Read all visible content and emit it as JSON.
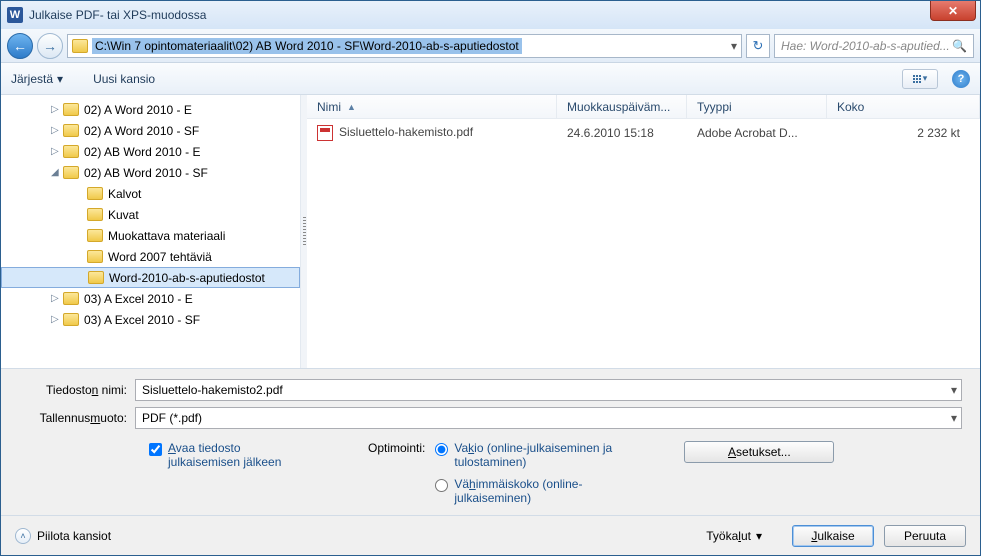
{
  "window": {
    "title": "Julkaise PDF- tai XPS-muodossa"
  },
  "nav": {
    "path": "C:\\Win 7 opintomateriaalit\\02) AB Word 2010 - SF\\Word-2010-ab-s-aputiedostot",
    "search_placeholder": "Hae: Word-2010-ab-s-aputied..."
  },
  "toolbar": {
    "organize": "Järjestä",
    "newfolder": "Uusi kansio"
  },
  "tree": [
    {
      "label": "02) A Word 2010 - E",
      "indent": 40,
      "exp": "▷"
    },
    {
      "label": "02) A Word 2010 - SF",
      "indent": 40,
      "exp": "▷"
    },
    {
      "label": "02) AB Word 2010 - E",
      "indent": 40,
      "exp": "▷"
    },
    {
      "label": "02) AB Word 2010 - SF",
      "indent": 40,
      "exp": "◢"
    },
    {
      "label": "Kalvot",
      "indent": 64,
      "exp": ""
    },
    {
      "label": "Kuvat",
      "indent": 64,
      "exp": ""
    },
    {
      "label": "Muokattava materiaali",
      "indent": 64,
      "exp": ""
    },
    {
      "label": "Word 2007 tehtäviä",
      "indent": 64,
      "exp": ""
    },
    {
      "label": "Word-2010-ab-s-aputiedostot",
      "indent": 64,
      "exp": "",
      "selected": true
    },
    {
      "label": "03) A Excel 2010 - E",
      "indent": 40,
      "exp": "▷"
    },
    {
      "label": "03) A Excel 2010 - SF",
      "indent": 40,
      "exp": "▷"
    }
  ],
  "columns": {
    "name": "Nimi",
    "modified": "Muokkauspäiväm...",
    "type": "Tyyppi",
    "size": "Koko"
  },
  "files": [
    {
      "name": "Sisluettelo-hakemisto.pdf",
      "modified": "24.6.2010 15:18",
      "type": "Adobe Acrobat D...",
      "size": "2 232 kt"
    }
  ],
  "form": {
    "filename_label": "Tiedoston nimi:",
    "filename_value": "Sisluettelo-hakemisto2.pdf",
    "saveas_label": "Tallennusmuoto:",
    "saveas_value": "PDF (*.pdf)"
  },
  "opts": {
    "openafter": "Avaa tiedosto julkaisemisen jälkeen",
    "optimize_label": "Optimointi:",
    "standard": "Vakio (online-julkaiseminen ja tulostaminen)",
    "minimum": "Vähimmäiskoko (online-julkaiseminen)",
    "settings_btn": "Asetukset..."
  },
  "footer": {
    "hide": "Piilota kansiot",
    "tools": "Työkalut",
    "publish": "Julkaise",
    "cancel": "Peruuta"
  }
}
